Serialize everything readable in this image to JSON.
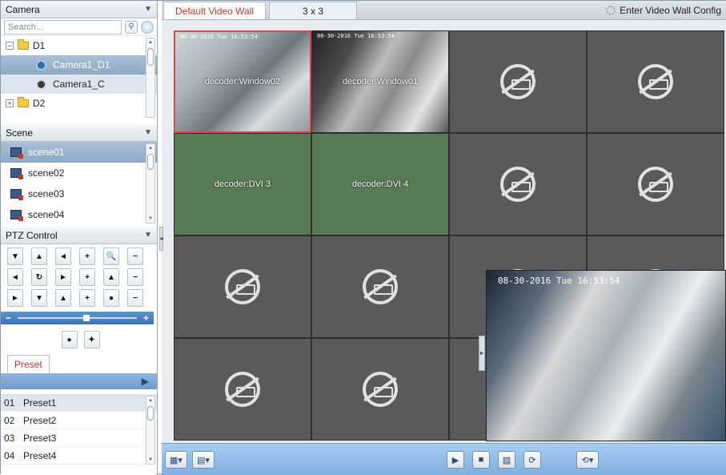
{
  "camera": {
    "header": "Camera",
    "search_placeholder": "Search...",
    "tree": [
      {
        "label": "D1",
        "type": "group",
        "expander": "−"
      },
      {
        "label": "Camera1_D1",
        "type": "camera"
      },
      {
        "label": "Camera1_C",
        "type": "camera"
      },
      {
        "label": "D2",
        "type": "group",
        "expander": "+"
      }
    ]
  },
  "scene": {
    "header": "Scene",
    "items": [
      "scene01",
      "scene02",
      "scene03",
      "scene04"
    ]
  },
  "ptz": {
    "header": "PTZ Control",
    "buttons": [
      "▼",
      "▲",
      "◄",
      "+",
      "🔍",
      "−",
      "◄",
      "↻",
      "►",
      "+",
      "▲",
      "−",
      "►",
      "▼",
      "▲",
      "+",
      "●",
      "−"
    ],
    "slider_minus": "−",
    "slider_plus": "+"
  },
  "preset": {
    "tab": "Preset",
    "play": "▶",
    "items": [
      {
        "num": "01",
        "name": "Preset1"
      },
      {
        "num": "02",
        "name": "Preset2"
      },
      {
        "num": "03",
        "name": "Preset3"
      },
      {
        "num": "04",
        "name": "Preset4"
      }
    ]
  },
  "main": {
    "tab_wall": "Default Video Wall",
    "tab_grid": "3 x 3",
    "config": "Enter Video Wall Config"
  },
  "wall": {
    "cells": [
      {
        "label": "decoder:Window02",
        "kind": "video",
        "osd": "08-30-2016 Tue 16:53:54"
      },
      {
        "label": "decoder:Window01",
        "kind": "video2",
        "osd": "08-30-2016 Tue 16:53:54"
      },
      {
        "label": "",
        "kind": "noconn"
      },
      {
        "label": "",
        "kind": "noconn"
      },
      {
        "label": "decoder:DVI 3",
        "kind": "green"
      },
      {
        "label": "decoder:DVI 4",
        "kind": "green"
      },
      {
        "label": "",
        "kind": "noconn"
      },
      {
        "label": "",
        "kind": "noconn"
      },
      {
        "label": "",
        "kind": "noconn"
      },
      {
        "label": "",
        "kind": "noconn"
      },
      {
        "label": "",
        "kind": "noconn"
      },
      {
        "label": "",
        "kind": "noconn"
      },
      {
        "label": "",
        "kind": "noconn"
      },
      {
        "label": "",
        "kind": "noconn"
      },
      {
        "label": "",
        "kind": "noconn"
      },
      {
        "label": "",
        "kind": "noconn"
      }
    ],
    "preview_osd": "08-30-2016 Tue 16:53:54"
  },
  "colors": {
    "accent": "#c0392b",
    "toolbar": "#8fbbe6",
    "decoder_cell": "#587a54"
  }
}
